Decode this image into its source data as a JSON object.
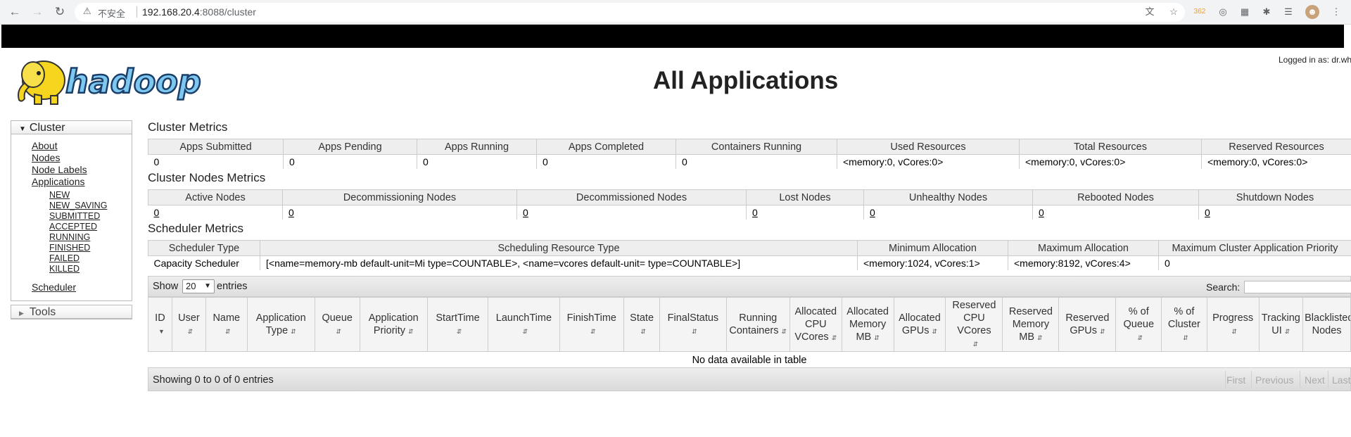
{
  "browser": {
    "security_label": "不安全",
    "url_host": "192.168.20.4",
    "url_rest": ":8088/cluster",
    "badge_text": "362"
  },
  "header": {
    "title": "All Applications",
    "logged_in": "Logged in as: dr.who",
    "logo_text": "hadoop"
  },
  "nav": {
    "cluster_label": "Cluster",
    "links": [
      "About",
      "Nodes",
      "Node Labels",
      "Applications"
    ],
    "app_states": [
      "NEW",
      "NEW_SAVING",
      "SUBMITTED",
      "ACCEPTED",
      "RUNNING",
      "FINISHED",
      "FAILED",
      "KILLED"
    ],
    "scheduler": "Scheduler",
    "tools_label": "Tools"
  },
  "cluster_metrics": {
    "title": "Cluster Metrics",
    "headers": [
      "Apps Submitted",
      "Apps Pending",
      "Apps Running",
      "Apps Completed",
      "Containers Running",
      "Used Resources",
      "Total Resources",
      "Reserved Resources"
    ],
    "values": [
      "0",
      "0",
      "0",
      "0",
      "0",
      "<memory:0, vCores:0>",
      "<memory:0, vCores:0>",
      "<memory:0, vCores:0>"
    ]
  },
  "node_metrics": {
    "title": "Cluster Nodes Metrics",
    "headers": [
      "Active Nodes",
      "Decommissioning Nodes",
      "Decommissioned Nodes",
      "Lost Nodes",
      "Unhealthy Nodes",
      "Rebooted Nodes",
      "Shutdown Nodes"
    ],
    "values": [
      "0",
      "0",
      "0",
      "0",
      "0",
      "0",
      "0"
    ]
  },
  "scheduler_metrics": {
    "title": "Scheduler Metrics",
    "headers": [
      "Scheduler Type",
      "Scheduling Resource Type",
      "Minimum Allocation",
      "Maximum Allocation",
      "Maximum Cluster Application Priority"
    ],
    "values": [
      "Capacity Scheduler",
      "[<name=memory-mb default-unit=Mi type=COUNTABLE>, <name=vcores default-unit= type=COUNTABLE>]",
      "<memory:1024, vCores:1>",
      "<memory:8192, vCores:4>",
      "0"
    ]
  },
  "apps_table": {
    "show_label": "Show",
    "page_size": "20",
    "entries_label": "entries",
    "search_label": "Search:",
    "columns": [
      "ID",
      "User",
      "Name",
      "Application Type",
      "Queue",
      "Application Priority",
      "StartTime",
      "LaunchTime",
      "FinishTime",
      "State",
      "FinalStatus",
      "Running Containers",
      "Allocated CPU VCores",
      "Allocated Memory MB",
      "Allocated GPUs",
      "Reserved CPU VCores",
      "Reserved Memory MB",
      "Reserved GPUs",
      "% of Queue",
      "% of Cluster",
      "Progress",
      "Tracking UI",
      "Blacklisted Nodes"
    ],
    "empty_message": "No data available in table",
    "info": "Showing 0 to 0 of 0 entries",
    "pager": [
      "First",
      "Previous",
      "Next",
      "Last"
    ]
  }
}
